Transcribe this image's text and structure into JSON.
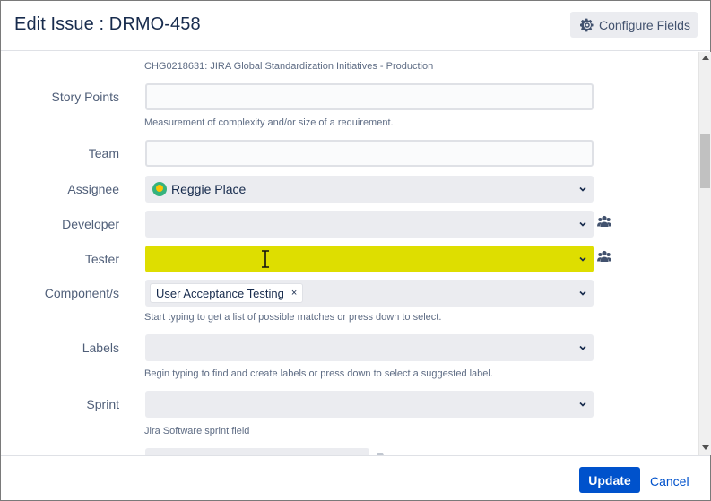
{
  "header": {
    "title": "Edit Issue : DRMO-458",
    "configure_fields_label": "Configure Fields",
    "configure_icon": "gear-icon"
  },
  "form": {
    "top_description": "CHG0218631: JIRA Global Standardization Initiatives - Production",
    "story_points": {
      "label": "Story Points",
      "value": "",
      "description": "Measurement of complexity and/or size of a requirement."
    },
    "team": {
      "label": "Team",
      "value": ""
    },
    "assignee": {
      "label": "Assignee",
      "value": "Reggie Place"
    },
    "developer": {
      "label": "Developer",
      "value": ""
    },
    "tester": {
      "label": "Tester",
      "value": "",
      "highlight_color": "#dede00"
    },
    "components": {
      "label": "Component/s",
      "selected": [
        "User Acceptance Testing"
      ],
      "remove_glyph": "×",
      "description": "Start typing to get a list of possible matches or press down to select."
    },
    "labels": {
      "label": "Labels",
      "value": "",
      "description": "Begin typing to find and create labels or press down to select a suggested label."
    },
    "sprint": {
      "label": "Sprint",
      "value": "",
      "description": "Jira Software sprint field"
    }
  },
  "footer": {
    "update_label": "Update",
    "cancel_label": "Cancel"
  },
  "colors": {
    "primary": "#0052cc",
    "select_bg": "#ebecf0",
    "tester_highlight": "#dede00",
    "text": "#172b4d",
    "label_text": "#505f79"
  }
}
